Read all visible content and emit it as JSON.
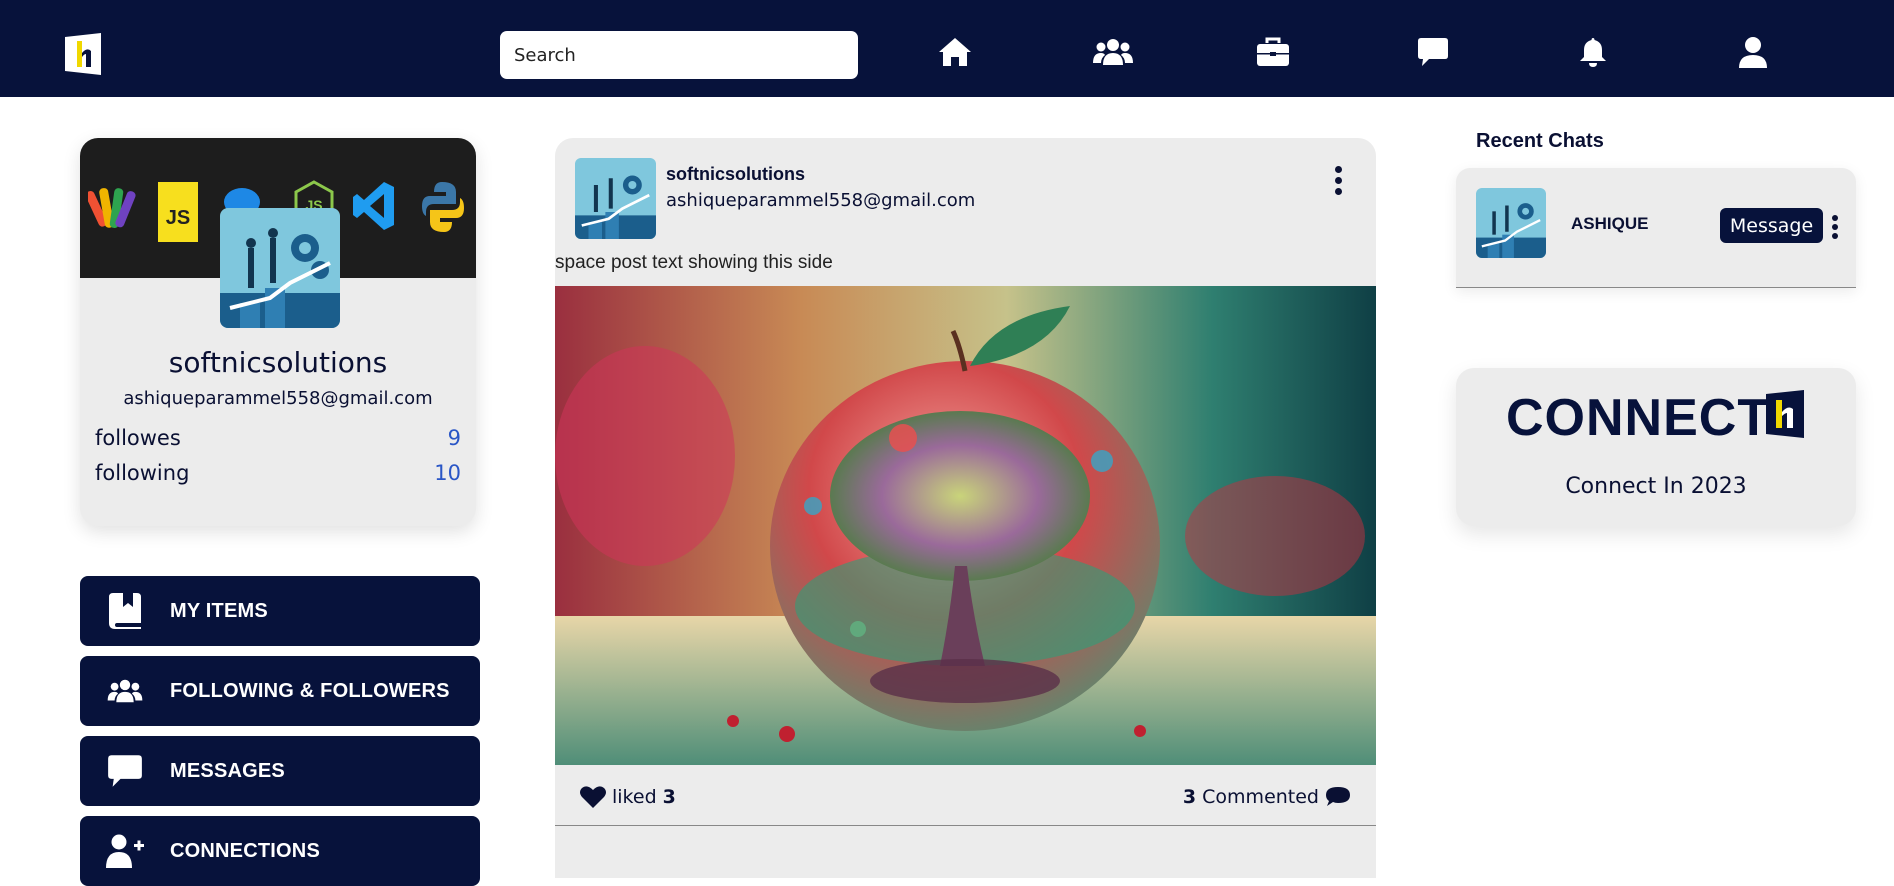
{
  "header": {
    "search": {
      "placeholder": "Search",
      "value": ""
    },
    "nav_icons": [
      "home-icon",
      "users-icon",
      "briefcase-icon",
      "chat-icon",
      "bell-icon",
      "user-icon"
    ]
  },
  "profile": {
    "name": "softnicsolutions",
    "email": "ashiqueparammel558@gmail.com",
    "stats": [
      {
        "label": "followes",
        "value": "9"
      },
      {
        "label": "following",
        "value": "10"
      }
    ],
    "cover_icons": [
      "git-icon",
      "javascript-icon",
      "react-icon",
      "nodejs-icon",
      "vscode-icon",
      "python-icon"
    ]
  },
  "sidebar": {
    "items": [
      {
        "label": "MY ITEMS",
        "icon": "bookmark-book-icon"
      },
      {
        "label": "FOLLOWING & FOLLOWERS",
        "icon": "users-icon"
      },
      {
        "label": "MESSAGES",
        "icon": "chat-icon"
      },
      {
        "label": "CONNECTIONS",
        "icon": "user-plus-icon"
      }
    ]
  },
  "post": {
    "user": "softnicsolutions",
    "email": "ashiqueparammel558@gmail.com",
    "text": "space post text showing this side",
    "liked_label": "liked",
    "liked_count": "3",
    "comment_count": "3",
    "commented_label": "Commented"
  },
  "recent_chats": {
    "title": "Recent Chats",
    "items": [
      {
        "name": "ASHIQUE",
        "button_label": "Message"
      }
    ]
  },
  "promo": {
    "title": "CONNECT",
    "subtitle": "Connect In 2023"
  },
  "colors": {
    "navy": "#07123b",
    "card": "#ececec",
    "stat_blue": "#2a56c6"
  }
}
